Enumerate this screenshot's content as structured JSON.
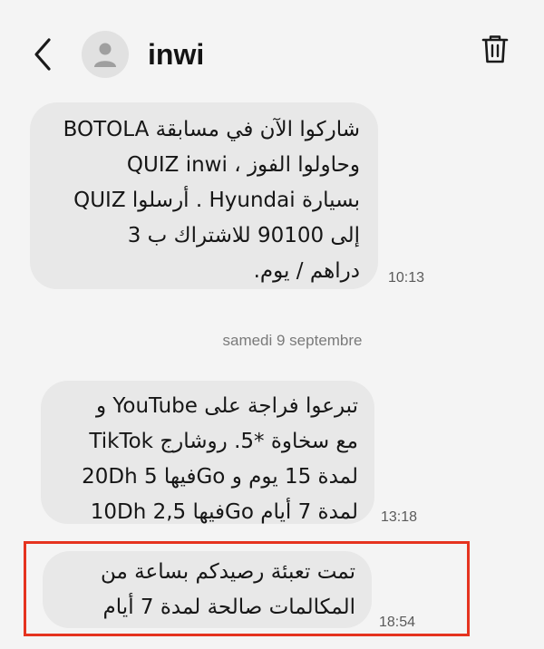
{
  "header": {
    "contact_name": "inwi",
    "back_icon": "chevron-left-icon",
    "avatar_icon": "person-icon",
    "delete_icon": "trash-icon"
  },
  "messages": [
    {
      "lines": [
        "شاركوا الآن في مسابقة BOTOLA",
        "QUIZ inwi ، وحاولوا الفوز",
        "بسيارة Hyundai . أرسلوا QUIZ",
        "إلى 90100 للاشتراك ب 3",
        "دراهم / يوم."
      ],
      "time": "10:13"
    },
    {
      "lines": [
        "تبرعوا فراجة على YouTube و",
        "TikTok مع سخاوة *5.  روشارج",
        "20Dh فيها 5Go  لمدة 15 يوم و",
        "10Dh فيها 2,5Go لمدة 7 أيام"
      ],
      "time": "13:18"
    },
    {
      "lines": [
        "تمت تعبئة رصيدكم بساعة من",
        "المكالمات صالحة لمدة 7 أيام"
      ],
      "time": "18:54"
    }
  ],
  "date_separator": "samedi 9 septembre",
  "colors": {
    "background": "#f4f4f4",
    "bubble": "#e8e8e8",
    "highlight": "#e5331f"
  }
}
